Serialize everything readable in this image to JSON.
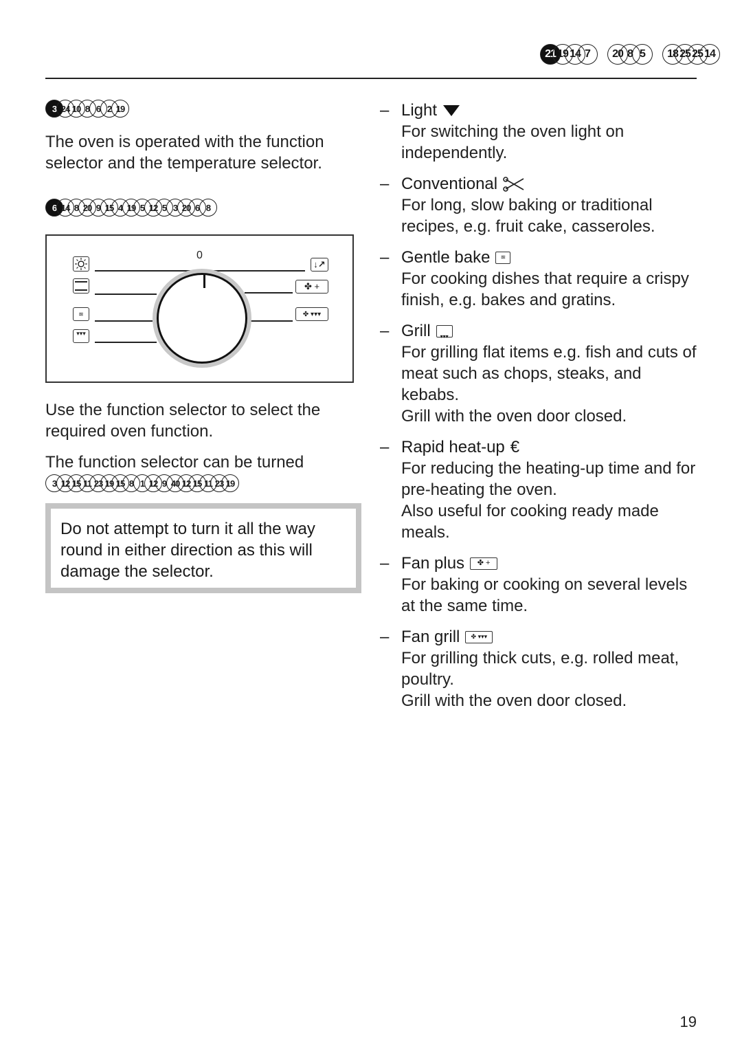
{
  "header": {
    "glyph_groups": [
      [
        {
          "t": "21",
          "filled": true
        },
        {
          "t": "19"
        },
        {
          "t": "14"
        },
        {
          "t": "7"
        }
      ],
      [
        {
          "t": "20"
        },
        {
          "t": "8"
        },
        {
          "t": "5"
        }
      ],
      [
        {
          "t": "18"
        },
        {
          "t": "25"
        },
        {
          "t": "25"
        },
        {
          "t": "14"
        }
      ]
    ]
  },
  "left": {
    "heading_glyphs": [
      {
        "t": "3",
        "filled": true
      },
      {
        "t": "24"
      },
      {
        "t": "10"
      },
      {
        "t": "8"
      },
      {
        "t": "6"
      },
      {
        "t": "2"
      },
      {
        "t": "19"
      }
    ],
    "intro": "The oven is operated with the function selector and the temperature selector.",
    "subheading_glyphs": [
      {
        "t": "6",
        "filled": true
      },
      {
        "t": "14"
      },
      {
        "t": "8"
      },
      {
        "t": "20"
      },
      {
        "t": "9"
      },
      {
        "t": "15"
      },
      {
        "t": "4"
      },
      {
        "t": "19"
      },
      {
        "t": "5"
      },
      {
        "t": "12"
      },
      {
        "t": "5"
      },
      {
        "t": "3"
      },
      {
        "t": "20"
      },
      {
        "t": "6"
      },
      {
        "t": "8"
      }
    ],
    "panel": {
      "zero_label": "0",
      "left_symbols": [
        "light-icon",
        "conventional-icon",
        "gentle-bake-icon",
        "grill-icon"
      ],
      "right_symbols": [
        "rapid-heat-up-icon",
        "fan-plus-icon",
        "fan-grill-icon"
      ]
    },
    "para1": "Use the function selector to select the required oven function.",
    "para2": "The function selector can be turned",
    "turn_glyphs": [
      {
        "t": "3"
      },
      {
        "t": "12"
      },
      {
        "t": "15"
      },
      {
        "t": "11"
      },
      {
        "t": "23"
      },
      {
        "t": "19"
      },
      {
        "t": "15"
      },
      {
        "t": "8"
      },
      {
        "t": "1"
      },
      {
        "t": "12"
      },
      {
        "t": "9"
      },
      {
        "t": "40"
      },
      {
        "t": "12"
      },
      {
        "t": "15"
      },
      {
        "t": "11"
      },
      {
        "t": "23"
      },
      {
        "t": "19"
      }
    ],
    "warning": "Do not attempt to turn it all the way round in either direction as this will damage the selector."
  },
  "functions": [
    {
      "title": "Light",
      "icon": "light-triangle-icon",
      "desc": [
        "For switching the oven light on independently."
      ]
    },
    {
      "title": "Conventional",
      "icon": "scissors-icon",
      "desc": [
        "For long, slow baking or traditional recipes, e.g. fruit cake, casseroles."
      ]
    },
    {
      "title": "Gentle bake",
      "icon": "gentle-bake-icon",
      "desc": [
        "For cooking dishes that require a crispy finish, e.g. bakes and gratins."
      ]
    },
    {
      "title": "Grill",
      "icon": "grill-icon",
      "desc": [
        "For grilling flat items e.g. fish and cuts of meat such as chops, steaks, and kebabs.",
        "Grill with the oven door closed."
      ]
    },
    {
      "title": "Rapid heat-up",
      "icon": "euro-icon",
      "desc": [
        "For reducing the heating-up time and for pre-heating the oven.",
        "Also useful for cooking ready made meals."
      ]
    },
    {
      "title": "Fan plus",
      "icon": "fan-plus-icon",
      "desc": [
        "For baking or cooking on several levels at the same time."
      ]
    },
    {
      "title": "Fan grill",
      "icon": "fan-grill-icon",
      "desc": [
        "For grilling thick cuts, e.g. rolled meat, poultry.",
        "Grill with the oven door closed."
      ]
    }
  ],
  "page_number": "19",
  "dash": "–",
  "euro": "€"
}
